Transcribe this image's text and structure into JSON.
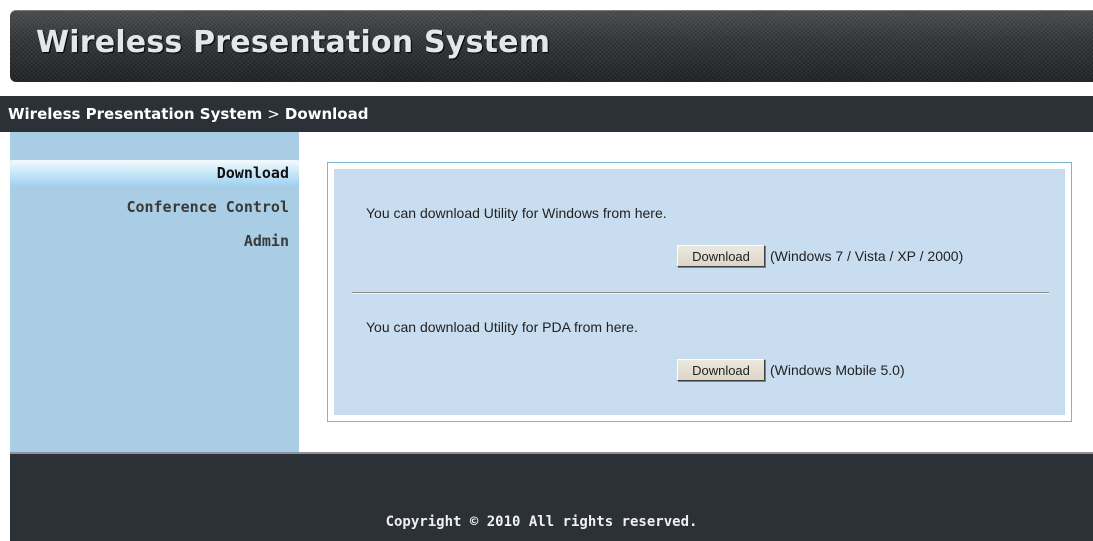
{
  "header": {
    "title": "Wireless Presentation System"
  },
  "breadcrumb": {
    "root": "Wireless Presentation System",
    "separator": ">",
    "current": "Download"
  },
  "sidebar": {
    "items": [
      {
        "label": "Download",
        "active": true
      },
      {
        "label": "Conference Control",
        "active": false
      },
      {
        "label": "Admin",
        "active": false
      }
    ]
  },
  "main": {
    "windows": {
      "text": "You can download Utility for Windows from here.",
      "button_label": "Download",
      "note": "(Windows 7 / Vista / XP / 2000)"
    },
    "pda": {
      "text": "You can download Utility for PDA from here.",
      "button_label": "Download",
      "note": "(Windows Mobile 5.0)"
    }
  },
  "footer": {
    "copyright": "Copyright © 2010 All rights reserved."
  },
  "colors": {
    "header_bg": "#232528",
    "bar_bg": "#2b3137",
    "sidebar_bg": "#a9cde4",
    "content_bg": "#c9ddf0",
    "content_border": "#7fb3d6"
  }
}
